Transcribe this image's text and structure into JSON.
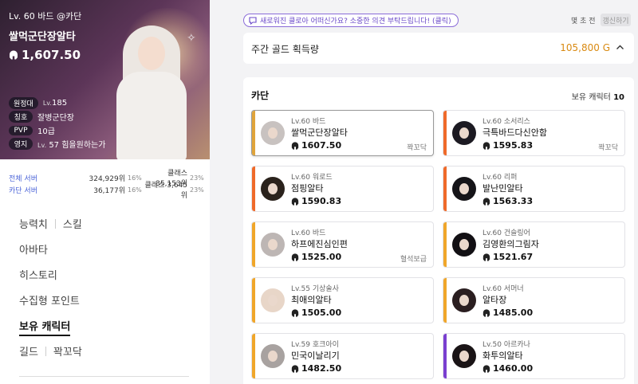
{
  "profile": {
    "subtitle": "Lv. 60 바드 @카단",
    "name": "쌀먹군단장알타",
    "item_level": "1,607.50",
    "info": [
      {
        "tag": "원정대",
        "lv": "Lv.",
        "value": "185"
      },
      {
        "tag": "칭호",
        "lv": "",
        "value": "잘병군단장"
      },
      {
        "tag": "PVP",
        "lv": "",
        "value": "10급"
      },
      {
        "tag": "영지",
        "lv": "Lv.",
        "value": "57 힘을원하는가"
      }
    ],
    "rankings": [
      {
        "label": "전체 서버",
        "rank1": "324,929위",
        "pct1": "16%",
        "rank2": "클래스 35,153위",
        "pct2": "23%"
      },
      {
        "label": "카단 서버",
        "rank1": "36,177위",
        "pct1": "16%",
        "rank2": "클래스 3,645위",
        "pct2": "23%"
      }
    ]
  },
  "nav": {
    "ability": "능력치",
    "skill": "스킬",
    "avatar": "아바타",
    "history": "히스토리",
    "collectibles": "수집형 포인트",
    "characters": "보유 캐릭터",
    "guild": "길드",
    "guild_name": "꽉꼬닥"
  },
  "notice": "새로워진 클로아 어떠신가요? 소중한 의견 부탁드립니다! (클릭)",
  "update": {
    "time_ago": "몇 초 전",
    "refresh_label": "갱신하기"
  },
  "gold": {
    "title": "주간 골드 획득량",
    "value": "105,800 G"
  },
  "roster": {
    "server": "카단",
    "count_label": "보유 캐릭터",
    "count": "10",
    "characters": [
      {
        "meta": "Lv.60 바드",
        "name": "쌀먹군단장알타",
        "ilvl": "1607.50",
        "guild": "꽉꼬닥",
        "accent": "#e0a43a",
        "selected": true
      },
      {
        "meta": "Lv.60 소서리스",
        "name": "극특바드다신안함",
        "ilvl": "1595.83",
        "guild": "꽉꼬닥",
        "accent": "#ef6a2a",
        "selected": false
      },
      {
        "meta": "Lv.60 워로드",
        "name": "점핑알타",
        "ilvl": "1590.83",
        "guild": "",
        "accent": "#ef6a2a",
        "selected": false
      },
      {
        "meta": "Lv.60 리퍼",
        "name": "발난민알타",
        "ilvl": "1563.33",
        "guild": "",
        "accent": "#ef6a2a",
        "selected": false
      },
      {
        "meta": "Lv.60 바드",
        "name": "하프에진심인편",
        "ilvl": "1525.00",
        "guild": "혈석보급",
        "accent": "#f0a62a",
        "selected": false
      },
      {
        "meta": "Lv.60 건슬링어",
        "name": "김영환의그림자",
        "ilvl": "1521.67",
        "guild": "",
        "accent": "#f0a62a",
        "selected": false
      },
      {
        "meta": "Lv.55 기상술사",
        "name": "최애의알타",
        "ilvl": "1505.00",
        "guild": "",
        "accent": "#f0a62a",
        "selected": false
      },
      {
        "meta": "Lv.60 서머너",
        "name": "알타장",
        "ilvl": "1485.00",
        "guild": "",
        "accent": "#f0a62a",
        "selected": false
      },
      {
        "meta": "Lv.59 호크아이",
        "name": "민국이날리기",
        "ilvl": "1482.50",
        "guild": "",
        "accent": "#f0a62a",
        "selected": false
      },
      {
        "meta": "Lv.50 아르카나",
        "name": "화투의알타",
        "ilvl": "1460.00",
        "guild": "",
        "accent": "#7a3fd0",
        "selected": false
      }
    ]
  },
  "colors": {
    "accent_purple": "#6a48c8",
    "gold": "#d98a12",
    "rank_blue": "#4a63d8"
  }
}
